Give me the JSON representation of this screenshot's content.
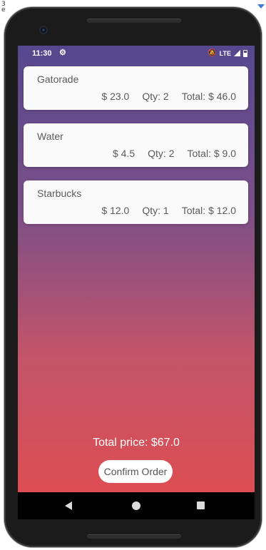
{
  "corner": {
    "text_line1": "3",
    "text_line2": "e"
  },
  "status": {
    "time": "11:30",
    "network": "LTE"
  },
  "items": [
    {
      "name": "Gatorade",
      "price": "$ 23.0",
      "qty": "Qty: 2",
      "total": "Total: $ 46.0"
    },
    {
      "name": "Water",
      "price": "$ 4.5",
      "qty": "Qty: 2",
      "total": "Total: $ 9.0"
    },
    {
      "name": "Starbucks",
      "price": "$ 12.0",
      "qty": "Qty: 1",
      "total": "Total: $ 12.0"
    }
  ],
  "summary": {
    "total_price": "Total price: $67.0",
    "confirm_label": "Confirm Order"
  },
  "icons": {
    "settings": "gear-icon",
    "mute": "mute-icon",
    "signal": "signal-icon",
    "battery": "battery-icon",
    "back": "back-icon",
    "home": "home-icon",
    "recents": "recents-icon"
  },
  "colors": {
    "gradient_top": "#55488f",
    "gradient_bottom": "#e24d4d",
    "card_bg": "#fafafa",
    "button_bg": "#ffffff"
  }
}
